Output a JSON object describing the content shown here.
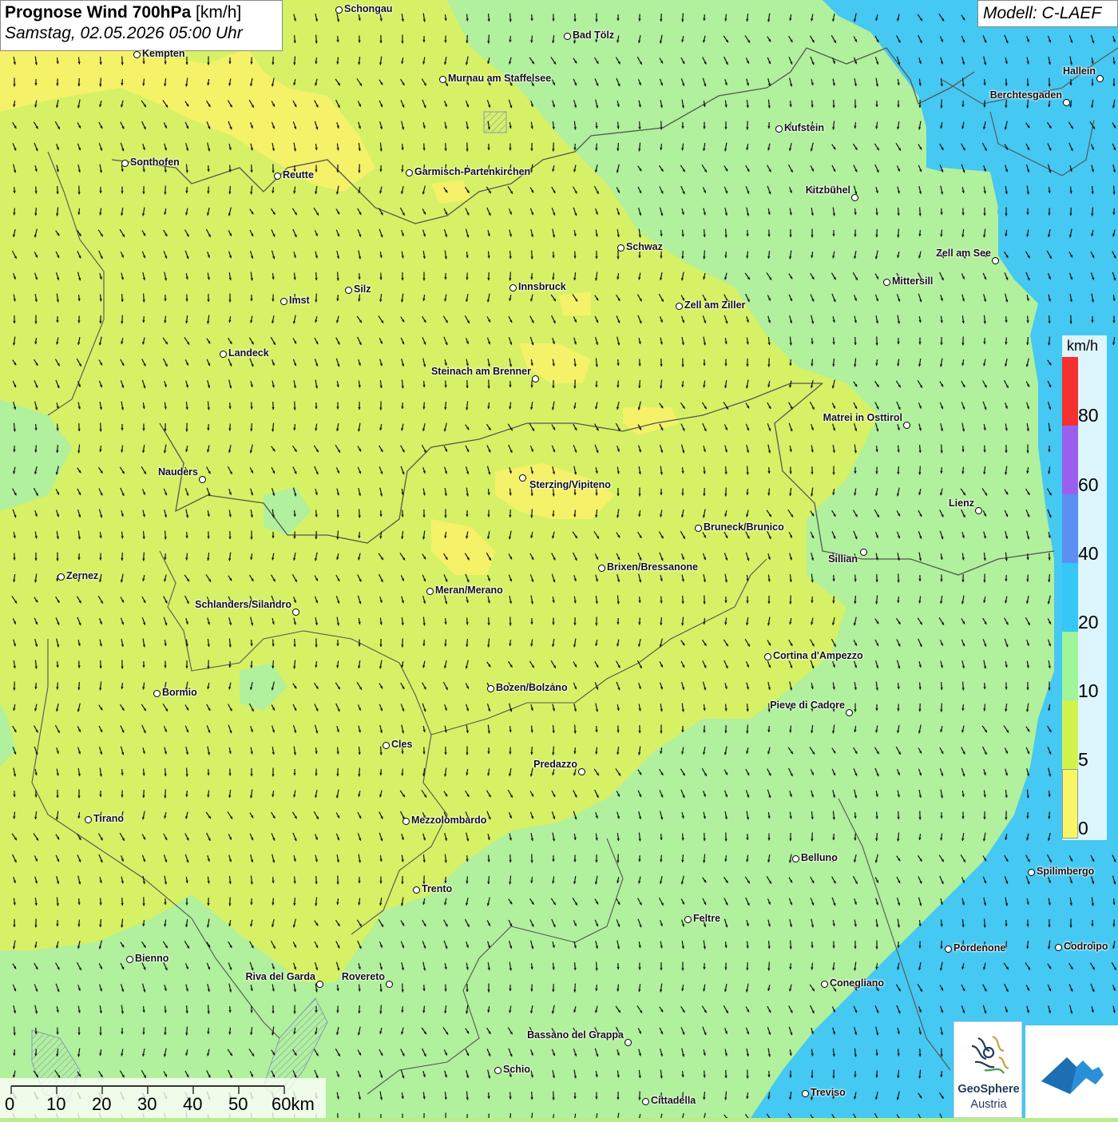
{
  "title": {
    "main_bold": "Prognose Wind 700hPa",
    "unit": "[km/h]",
    "datetime": "Samstag, 02.05.2026 05:00 Uhr"
  },
  "model_label": "Modell: C-LAEF",
  "legend": {
    "unit": "km/h",
    "ticks": [
      "80",
      "60",
      "40",
      "20",
      "10",
      "5",
      "0"
    ],
    "colors": {
      "0-5": "#f7f765",
      "5-10": "#d2f24e",
      "10-20": "#9ff59a",
      "20-40": "#35c7f5",
      "40-60": "#5b8ff1",
      "60-80": "#9b5ff0",
      "80+": "#f53030"
    }
  },
  "scale": {
    "labels": [
      "0",
      "10",
      "20",
      "30",
      "40",
      "50",
      "60km"
    ]
  },
  "wind_summary": {
    "predominant_direction": "north-west to south-east",
    "speed_band_south_tyrol_north_tyrol": "5-10",
    "speed_band_east_and_south": "10-20",
    "speed_band_far_east_edges": "20-40"
  },
  "cities": [
    {
      "name": "Schongau"
    },
    {
      "name": "Bad Tölz"
    },
    {
      "name": "Kempten"
    },
    {
      "name": "Murnau am Staffelsee"
    },
    {
      "name": "Hallein"
    },
    {
      "name": "Berchtesgaden"
    },
    {
      "name": "Kufstein"
    },
    {
      "name": "Sonthofen"
    },
    {
      "name": "Reutte"
    },
    {
      "name": "Garmisch-Partenkirchen"
    },
    {
      "name": "Kitzbühel"
    },
    {
      "name": "Schwaz"
    },
    {
      "name": "Zell am See"
    },
    {
      "name": "Mittersill"
    },
    {
      "name": "Innsbruck"
    },
    {
      "name": "Silz"
    },
    {
      "name": "Imst"
    },
    {
      "name": "Zell am Ziller"
    },
    {
      "name": "Landeck"
    },
    {
      "name": "Steinach am Brenner"
    },
    {
      "name": "Matrei in Osttirol"
    },
    {
      "name": "Nauders"
    },
    {
      "name": "Sterzing/Vipiteno"
    },
    {
      "name": "Lienz"
    },
    {
      "name": "Bruneck/Brunico"
    },
    {
      "name": "Sillian"
    },
    {
      "name": "Brixen/Bressanone"
    },
    {
      "name": "Zernez"
    },
    {
      "name": "Meran/Merano"
    },
    {
      "name": "Schlanders/Silandro"
    },
    {
      "name": "Cortina d'Ampezzo"
    },
    {
      "name": "Bozen/Bolzano"
    },
    {
      "name": "Bormio"
    },
    {
      "name": "Pieve di Cadore"
    },
    {
      "name": "Cles"
    },
    {
      "name": "Predazzo"
    },
    {
      "name": "Tirano"
    },
    {
      "name": "Mezzolombardo"
    },
    {
      "name": "Belluno"
    },
    {
      "name": "Spilimbergo"
    },
    {
      "name": "Trento"
    },
    {
      "name": "Feltre"
    },
    {
      "name": "Pordenone"
    },
    {
      "name": "Codroipo"
    },
    {
      "name": "Bienno"
    },
    {
      "name": "Riva del Garda"
    },
    {
      "name": "Rovereto"
    },
    {
      "name": "Conegliano"
    },
    {
      "name": "Bassano del Grappa"
    },
    {
      "name": "Schio"
    },
    {
      "name": "Treviso"
    },
    {
      "name": "Cittadella"
    }
  ],
  "logos": {
    "geosphere_line1": "GeoSphere",
    "geosphere_line2": "Austria"
  }
}
